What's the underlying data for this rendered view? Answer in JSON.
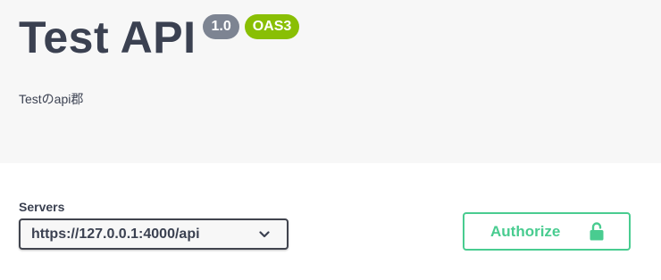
{
  "info": {
    "title": "Test API",
    "version": "1.0",
    "spec_badge": "OAS3",
    "description": "Testのapi郡"
  },
  "servers": {
    "label": "Servers",
    "selected": "https://127.0.0.1:4000/api"
  },
  "authorize": {
    "label": "Authorize"
  },
  "colors": {
    "title_text": "#3b4151",
    "version_badge": "#7d8492",
    "oas_badge": "#89bf04",
    "authorize_accent": "#49cc90",
    "info_background": "#f7f7f7"
  },
  "icons": {
    "server_dropdown": "chevron-down-icon",
    "authorize": "unlocked-padlock-icon"
  }
}
